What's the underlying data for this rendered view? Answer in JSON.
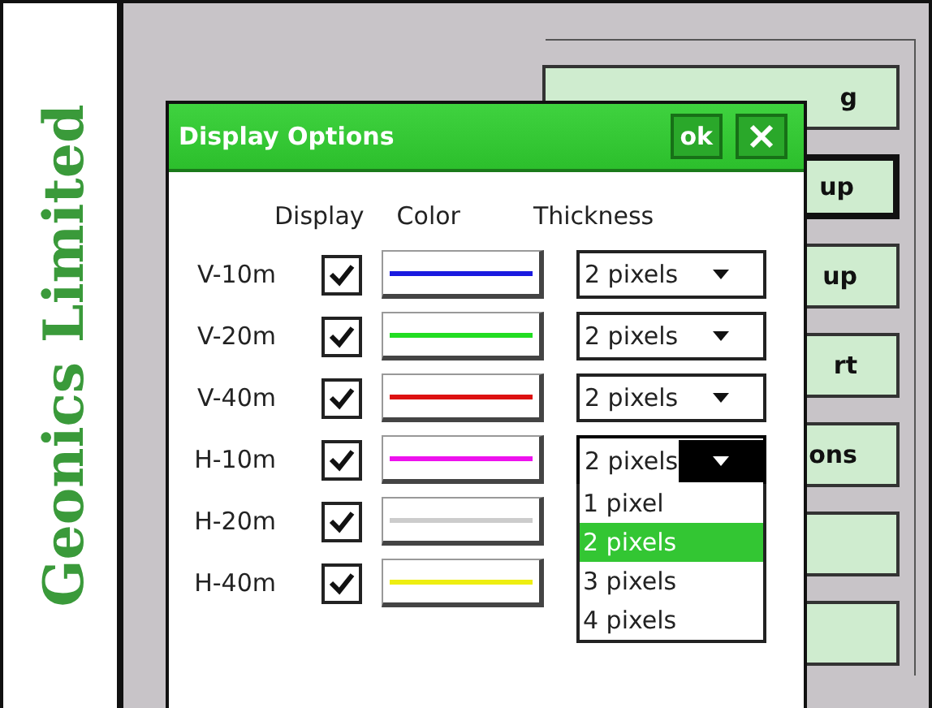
{
  "brand": {
    "text": "Geonics Limited"
  },
  "background_buttons": [
    {
      "label": "g",
      "selected": false
    },
    {
      "label": "up",
      "selected": true
    },
    {
      "label": "up",
      "selected": false
    },
    {
      "label": "rt",
      "selected": false
    },
    {
      "label": "ons",
      "selected": false
    },
    {
      "selected": false
    },
    {
      "selected": false
    }
  ],
  "dialog": {
    "title": "Display Options",
    "ok": "ok",
    "columns": [
      "Display",
      "Color",
      "Thickness"
    ],
    "rows": [
      {
        "name": "V-10m",
        "checked": true,
        "color": "#1a1ae0",
        "thickness": "2 pixels",
        "expanded": false
      },
      {
        "name": "V-20m",
        "checked": true,
        "color": "#22dd22",
        "thickness": "2 pixels",
        "expanded": false
      },
      {
        "name": "V-40m",
        "checked": true,
        "color": "#dd1111",
        "thickness": "2 pixels",
        "expanded": false
      },
      {
        "name": "H-10m",
        "checked": true,
        "color": "#ee11ee",
        "thickness": "2 pixels",
        "expanded": true,
        "options": [
          {
            "label": "1 pixel",
            "selected": false
          },
          {
            "label": "2 pixels",
            "selected": true
          },
          {
            "label": "3 pixels",
            "selected": false
          },
          {
            "label": "4 pixels",
            "selected": false
          }
        ]
      },
      {
        "name": "H-20m",
        "checked": true,
        "color": "#cccccc"
      },
      {
        "name": "H-40m",
        "checked": true,
        "color": "#eeee11"
      }
    ]
  }
}
